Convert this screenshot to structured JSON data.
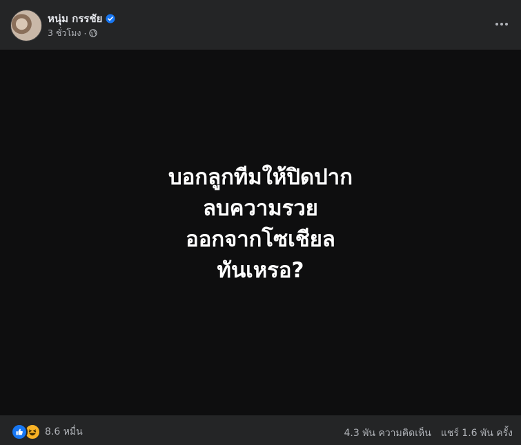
{
  "post": {
    "author": "หนุ่ม กรรชัย",
    "time": "3 ชั่วโมง",
    "separator": "·",
    "privacy_icon": "globe-icon",
    "verified_icon": "verified-badge-icon",
    "more_icon": "more-options-icon"
  },
  "image_text": {
    "line1": "บอกลูกทีมให้ปิดปาก￼",
    "line2": "ลบความรวย",
    "line3": "ออกจากโซเชียล",
    "line4": "ทันเหรอ?"
  },
  "footer": {
    "reaction_icons": [
      "like-icon",
      "haha-icon"
    ],
    "reaction_count": "8.6 หมื่น",
    "comments": "4.3 พัน ความคิดเห็น",
    "shares": "แชร์ 1.6 พัน ครั้ง"
  },
  "colors": {
    "background": "#242526",
    "image_bg": "#0e0e0f",
    "verified": "#1877f2",
    "secondary_text": "#b0b3b8"
  }
}
